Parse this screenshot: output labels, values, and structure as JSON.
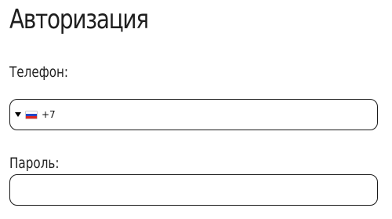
{
  "form": {
    "title": "Авторизация",
    "phone": {
      "label": "Телефон:",
      "country_flag": "russia-flag-icon",
      "dial_code": "+7",
      "value": "",
      "placeholder": ""
    },
    "password": {
      "label": "Пароль:",
      "value": "",
      "placeholder": ""
    }
  },
  "colors": {
    "text": "#1e1e1e",
    "border": "#1a1a1a",
    "background": "#ffffff"
  }
}
